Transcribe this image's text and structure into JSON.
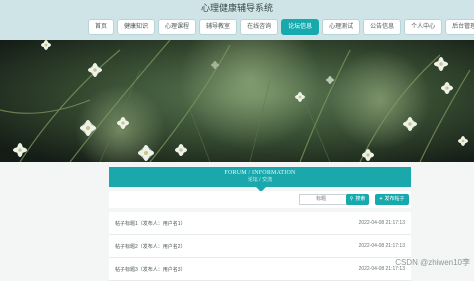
{
  "site": {
    "title": "心理健康辅导系统"
  },
  "nav": {
    "items": [
      {
        "label": "首页",
        "active": false
      },
      {
        "label": "健康知识",
        "active": false
      },
      {
        "label": "心理课程",
        "active": false
      },
      {
        "label": "辅导教室",
        "active": false
      },
      {
        "label": "在线咨询",
        "active": false
      },
      {
        "label": "论坛信息",
        "active": true
      },
      {
        "label": "心理测试",
        "active": false
      },
      {
        "label": "公告信息",
        "active": false
      },
      {
        "label": "个人中心",
        "active": false
      },
      {
        "label": "后台管理",
        "active": false
      }
    ]
  },
  "forum": {
    "title": "FORUM / INFORMATION",
    "subtitle": "论坛 / 交流"
  },
  "toolbar": {
    "search_placeholder": "标题",
    "search_label": "搜索",
    "add_label": "发布帖子"
  },
  "posts": [
    {
      "title": "帖子标题1（发布人：用户名1）",
      "time": "2022-04-08 21:17:13"
    },
    {
      "title": "帖子标题2（发布人：用户名2）",
      "time": "2022-04-08 21:17:13"
    },
    {
      "title": "帖子标题3（发布人：用户名3）",
      "time": "2022-04-08 21:17:13"
    }
  ],
  "watermark": "CSDN @zhiwen10李",
  "colors": {
    "accent": "#16a9ad",
    "header_bg": "#cfe4e6"
  }
}
